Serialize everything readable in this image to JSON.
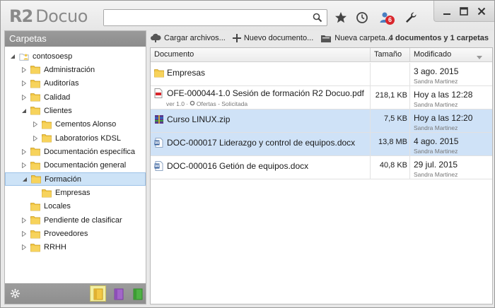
{
  "app": {
    "logo_r2": "R2",
    "logo_docuo": "Docuo",
    "notification_count": "6"
  },
  "search": {
    "value": "",
    "placeholder": ""
  },
  "left_panel": {
    "header": "Carpetas",
    "tree": [
      {
        "label": "contosoesp",
        "level": 0,
        "expanded": true,
        "type": "root"
      },
      {
        "label": "Administración",
        "level": 1,
        "expanded": false
      },
      {
        "label": "Auditorías",
        "level": 1,
        "expanded": false
      },
      {
        "label": "Calidad",
        "level": 1,
        "expanded": false
      },
      {
        "label": "Clientes",
        "level": 1,
        "expanded": true
      },
      {
        "label": "Cementos Alonso",
        "level": 2,
        "expanded": false
      },
      {
        "label": "Laboratorios KDSL",
        "level": 2,
        "expanded": false
      },
      {
        "label": "Documentación específica",
        "level": 1,
        "expanded": false
      },
      {
        "label": "Documentación general",
        "level": 1,
        "expanded": false
      },
      {
        "label": "Formación",
        "level": 1,
        "expanded": true,
        "selected": true
      },
      {
        "label": "Empresas",
        "level": 2,
        "expanded": null
      },
      {
        "label": "Locales",
        "level": 1,
        "expanded": null
      },
      {
        "label": "Pendiente de clasificar",
        "level": 1,
        "expanded": false
      },
      {
        "label": "Proveedores",
        "level": 1,
        "expanded": false
      },
      {
        "label": "RRHH",
        "level": 1,
        "expanded": false
      }
    ]
  },
  "toolbar": {
    "upload": "Cargar archivos...",
    "new_document": "Nuevo documento...",
    "new_folder": "Nueva carpeta...",
    "count": "4 documentos y 1 carpetas"
  },
  "table": {
    "columns": {
      "name": "Documento",
      "size": "Tamaño",
      "modified": "Modificado"
    },
    "rows": [
      {
        "name": "Empresas",
        "type": "folder",
        "size": "",
        "date": "3 ago. 2015",
        "user": "Sandra Martinez",
        "sub": "",
        "selected": false
      },
      {
        "name": "OFE-000044-1.0 Sesión de formación R2 Docuo.pdf",
        "type": "pdf",
        "size": "218,1 KB",
        "date": "Hoy a las 12:28",
        "user": "Sandra Martinez",
        "sub_version": "ver 1.0",
        "sub_status": "Ofertas - Solicitada",
        "selected": false
      },
      {
        "name": "Curso LINUX.zip",
        "type": "zip",
        "size": "7,5 KB",
        "date": "Hoy a las 12:20",
        "user": "Sandra Martinez",
        "sub": "",
        "selected": true
      },
      {
        "name": "DOC-000017 Liderazgo y control de equipos.docx",
        "type": "docx",
        "size": "13,8 MB",
        "date": "4 ago. 2015",
        "user": "Sandra Martinez",
        "sub": "",
        "selected": true
      },
      {
        "name": "DOC-000016 Getión de equipos.docx",
        "type": "docx",
        "size": "40,8 KB",
        "date": "29 jul. 2015",
        "user": "Sandra Martinez",
        "sub": "",
        "selected": false
      }
    ]
  },
  "colors": {
    "selection": "#cfe2f7",
    "panel_header": "#969696",
    "folder": "#f2c744",
    "badge": "#d9262c"
  }
}
